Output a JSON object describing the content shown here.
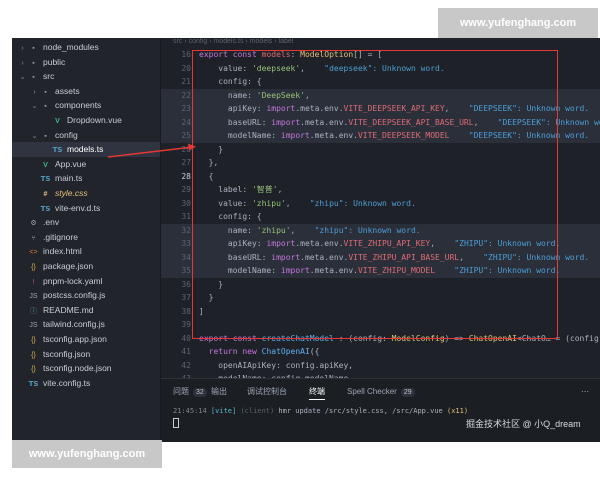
{
  "watermarks": {
    "top": "www.yufenghang.com",
    "bottom": "www.yufenghang.com"
  },
  "breadcrumb": [
    "src",
    "config",
    "models.ts",
    "models",
    "label"
  ],
  "explorer": [
    {
      "label": "node_modules",
      "type": "folder",
      "icon": "folder-icon",
      "depth": 0,
      "chevron": "right"
    },
    {
      "label": "public",
      "type": "folder",
      "icon": "folder-icon",
      "depth": 0,
      "chevron": "right"
    },
    {
      "label": "src",
      "type": "folder",
      "icon": "folder-icon",
      "depth": 0,
      "chevron": "down"
    },
    {
      "label": "assets",
      "type": "folder",
      "icon": "folder-icon",
      "depth": 1,
      "chevron": "right"
    },
    {
      "label": "components",
      "type": "folder",
      "icon": "folder-icon",
      "depth": 1,
      "chevron": "down"
    },
    {
      "label": "Dropdown.vue",
      "type": "vue",
      "icon": "vue-file-icon",
      "depth": 2,
      "chevron": ""
    },
    {
      "label": "config",
      "type": "folder",
      "icon": "folder-icon",
      "depth": 1,
      "chevron": "down"
    },
    {
      "label": "models.ts",
      "type": "ts",
      "icon": "ts-file-icon",
      "depth": 2,
      "chevron": "",
      "selected": true
    },
    {
      "label": "App.vue",
      "type": "vue",
      "icon": "vue-file-icon",
      "depth": 1,
      "chevron": ""
    },
    {
      "label": "main.ts",
      "type": "ts",
      "icon": "ts-file-icon",
      "depth": 1,
      "chevron": ""
    },
    {
      "label": "style.css",
      "type": "css",
      "icon": "css-file-icon",
      "depth": 1,
      "chevron": ""
    },
    {
      "label": "vite-env.d.ts",
      "type": "ts",
      "icon": "ts-file-icon",
      "depth": 1,
      "chevron": ""
    },
    {
      "label": ".env",
      "type": "env",
      "icon": "gear-icon",
      "depth": 0,
      "chevron": ""
    },
    {
      "label": ".gitignore",
      "type": "git",
      "icon": "git-icon",
      "depth": 0,
      "chevron": ""
    },
    {
      "label": "index.html",
      "type": "html",
      "icon": "html-file-icon",
      "depth": 0,
      "chevron": ""
    },
    {
      "label": "package.json",
      "type": "json",
      "icon": "json-file-icon",
      "depth": 0,
      "chevron": ""
    },
    {
      "label": "pnpm-lock.yaml",
      "type": "yaml",
      "icon": "yaml-file-icon",
      "depth": 0,
      "chevron": ""
    },
    {
      "label": "postcss.config.js",
      "type": "js",
      "icon": "js-file-icon",
      "depth": 0,
      "chevron": ""
    },
    {
      "label": "README.md",
      "type": "md",
      "icon": "md-file-icon",
      "depth": 0,
      "chevron": ""
    },
    {
      "label": "tailwind.config.js",
      "type": "js",
      "icon": "js-file-icon",
      "depth": 0,
      "chevron": ""
    },
    {
      "label": "tsconfig.app.json",
      "type": "json",
      "icon": "json-file-icon",
      "depth": 0,
      "chevron": ""
    },
    {
      "label": "tsconfig.json",
      "type": "json",
      "icon": "json-file-icon",
      "depth": 0,
      "chevron": ""
    },
    {
      "label": "tsconfig.node.json",
      "type": "json",
      "icon": "json-file-icon",
      "depth": 0,
      "chevron": ""
    },
    {
      "label": "vite.config.ts",
      "type": "ts",
      "icon": "ts-file-icon",
      "depth": 0,
      "chevron": ""
    }
  ],
  "editor": {
    "current_line": "28",
    "lines": [
      {
        "n": "16",
        "hl": false,
        "tokens": [
          [
            "kw",
            "export const "
          ],
          [
            "prop",
            "models"
          ],
          [
            "pl",
            ": "
          ],
          [
            "ty",
            "ModelOption"
          ],
          [
            "pl",
            "[] = ["
          ]
        ]
      },
      {
        "n": "20",
        "hl": false,
        "tokens": [
          [
            "pl",
            "    value: "
          ],
          [
            "str",
            "'deepseek'"
          ],
          [
            "pl",
            ",    "
          ],
          [
            "warn",
            "\"deepseek\": Unknown word."
          ]
        ]
      },
      {
        "n": "21",
        "hl": false,
        "tokens": [
          [
            "pl",
            "    config: {"
          ]
        ]
      },
      {
        "n": "22",
        "hl": true,
        "tokens": [
          [
            "pl",
            "      name: "
          ],
          [
            "str",
            "'DeepSeek'"
          ],
          [
            "pl",
            ","
          ]
        ]
      },
      {
        "n": "23",
        "hl": true,
        "tokens": [
          [
            "pl",
            "      apiKey: "
          ],
          [
            "kw",
            "import"
          ],
          [
            "pl",
            ".meta.env."
          ],
          [
            "prop",
            "VITE_DEEPSEEK_API_KEY"
          ],
          [
            "pl",
            ",    "
          ],
          [
            "warn",
            "\"DEEPSEEK\": Unknown word."
          ]
        ]
      },
      {
        "n": "24",
        "hl": true,
        "tokens": [
          [
            "pl",
            "      baseURL: "
          ],
          [
            "kw",
            "import"
          ],
          [
            "pl",
            ".meta.env."
          ],
          [
            "prop",
            "VITE_DEEPSEEK_API_BASE_URL"
          ],
          [
            "pl",
            ",    "
          ],
          [
            "warn",
            "\"DEEPSEEK\": Unknown word."
          ]
        ]
      },
      {
        "n": "25",
        "hl": true,
        "tokens": [
          [
            "pl",
            "      modelName: "
          ],
          [
            "kw",
            "import"
          ],
          [
            "pl",
            ".meta.env."
          ],
          [
            "prop",
            "VITE_DEEPSEEK_MODEL"
          ],
          [
            "pl",
            "    "
          ],
          [
            "warn",
            "\"DEEPSEEK\": Unknown word."
          ]
        ]
      },
      {
        "n": "26",
        "hl": false,
        "tokens": [
          [
            "pl",
            "    }"
          ]
        ]
      },
      {
        "n": "27",
        "hl": false,
        "tokens": [
          [
            "pl",
            "  },"
          ]
        ]
      },
      {
        "n": "28",
        "hl": false,
        "tokens": [
          [
            "pl",
            "  {"
          ]
        ]
      },
      {
        "n": "29",
        "hl": false,
        "tokens": [
          [
            "pl",
            "    label: "
          ],
          [
            "str",
            "'智普'"
          ],
          [
            "pl",
            ","
          ]
        ]
      },
      {
        "n": "30",
        "hl": false,
        "tokens": [
          [
            "pl",
            "    value: "
          ],
          [
            "str",
            "'zhipu'"
          ],
          [
            "pl",
            ",    "
          ],
          [
            "warn",
            "\"zhipu\": Unknown word."
          ]
        ]
      },
      {
        "n": "31",
        "hl": false,
        "tokens": [
          [
            "pl",
            "    config: {"
          ]
        ]
      },
      {
        "n": "32",
        "hl": true,
        "tokens": [
          [
            "pl",
            "      name: "
          ],
          [
            "str",
            "'zhipu'"
          ],
          [
            "pl",
            ",    "
          ],
          [
            "warn",
            "\"zhipu\": Unknown word."
          ]
        ]
      },
      {
        "n": "33",
        "hl": true,
        "tokens": [
          [
            "pl",
            "      apiKey: "
          ],
          [
            "kw",
            "import"
          ],
          [
            "pl",
            ".meta.env."
          ],
          [
            "prop",
            "VITE_ZHIPU_API_KEY"
          ],
          [
            "pl",
            ",    "
          ],
          [
            "warn",
            "\"ZHIPU\": Unknown word."
          ]
        ]
      },
      {
        "n": "34",
        "hl": true,
        "tokens": [
          [
            "pl",
            "      baseURL: "
          ],
          [
            "kw",
            "import"
          ],
          [
            "pl",
            ".meta.env."
          ],
          [
            "prop",
            "VITE_ZHIPU_API_BASE_URL"
          ],
          [
            "pl",
            ",    "
          ],
          [
            "warn",
            "\"ZHIPU\": Unknown word."
          ]
        ]
      },
      {
        "n": "35",
        "hl": true,
        "tokens": [
          [
            "pl",
            "      modelName: "
          ],
          [
            "kw",
            "import"
          ],
          [
            "pl",
            ".meta.env."
          ],
          [
            "prop",
            "VITE_ZHIPU_MODEL"
          ],
          [
            "pl",
            "    "
          ],
          [
            "warn",
            "\"ZHIPU\": Unknown word."
          ]
        ]
      },
      {
        "n": "36",
        "hl": false,
        "tokens": [
          [
            "pl",
            "    }"
          ]
        ]
      },
      {
        "n": "37",
        "hl": false,
        "tokens": [
          [
            "pl",
            "  }"
          ]
        ]
      },
      {
        "n": "38",
        "hl": false,
        "tokens": [
          [
            "pl",
            "]"
          ]
        ]
      },
      {
        "n": "39",
        "hl": false,
        "tokens": []
      },
      {
        "n": "40",
        "hl": false,
        "tokens": [
          [
            "kw",
            "export const "
          ],
          [
            "fn",
            "createChatModel"
          ],
          [
            "pl",
            " : (config: "
          ],
          [
            "ty",
            "ModelConfig"
          ],
          [
            "pl",
            ") => "
          ],
          [
            "ty",
            "ChatOpenAI"
          ],
          [
            "pl",
            "<ChatO… = (config:"
          ]
        ]
      },
      {
        "n": "41",
        "hl": false,
        "tokens": [
          [
            "pl",
            "  "
          ],
          [
            "kw",
            "return new "
          ],
          [
            "fn",
            "ChatOpenAI"
          ],
          [
            "pl",
            "({"
          ]
        ]
      },
      {
        "n": "42",
        "hl": false,
        "tokens": [
          [
            "pl",
            "    openAIApiKey: config.apiKey,"
          ]
        ]
      },
      {
        "n": "43",
        "hl": false,
        "tokens": [
          [
            "pl",
            "    modelName: config.modelName,"
          ]
        ]
      }
    ]
  },
  "panel": {
    "tabs": [
      {
        "label": "问题",
        "badge": "32"
      },
      {
        "label": "输出",
        "badge": ""
      },
      {
        "label": "调试控制台",
        "badge": ""
      },
      {
        "label": "终端",
        "badge": "",
        "active": true
      },
      {
        "label": "Spell Checker",
        "badge": "29"
      }
    ],
    "terminal": {
      "time": "21:45:14",
      "tag": "[vite]",
      "client": "(client)",
      "message": "hmr update /src/style.css, /src/App.vue",
      "count": "(x11)"
    },
    "attribution": "掘金技术社区 @ 小Q_dream"
  },
  "colors": {
    "highlight_box": "#e53935",
    "arrow": "#e53935"
  }
}
